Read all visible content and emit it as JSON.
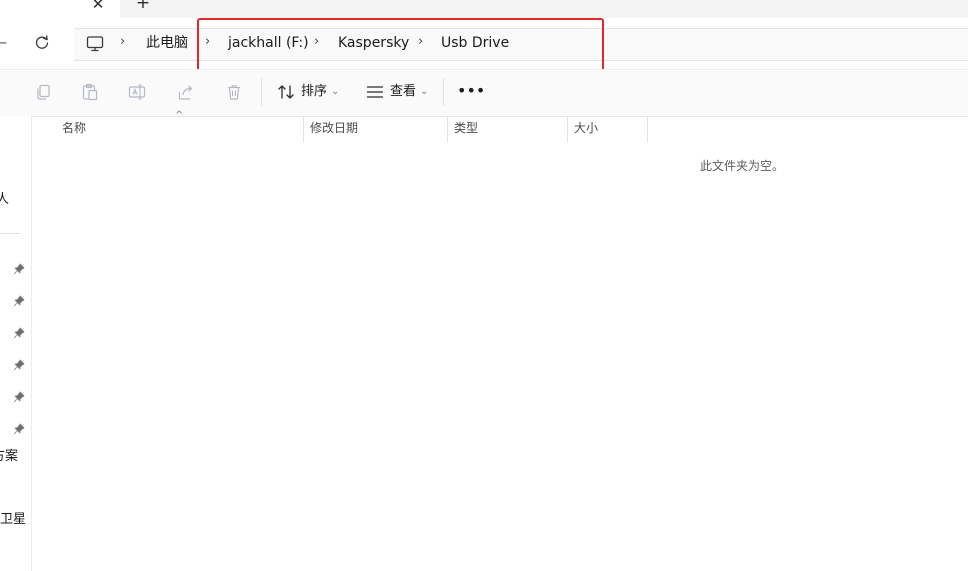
{
  "tabs": {
    "close_glyph": "✕",
    "new_tab_glyph": "+"
  },
  "nav": {
    "back_glyph": "←",
    "breadcrumb": {
      "root": "此电脑",
      "items": [
        "jackhall (F:)",
        "Kaspersky",
        "Usb Drive"
      ],
      "separator": "›"
    }
  },
  "toolbar": {
    "sort_label": "排序",
    "view_label": "查看",
    "more_glyph": "•••",
    "caret_glyph": "⌄"
  },
  "sidebar": {
    "partial_labels": [
      "人",
      "方案",
      "卫星"
    ]
  },
  "columns": {
    "name": "名称",
    "modified": "修改日期",
    "type": "类型",
    "size": "大小",
    "sort_caret": "^"
  },
  "content": {
    "empty_message": "此文件夹为空。"
  },
  "colors": {
    "highlight": "#e02a2a",
    "background": "#ffffff",
    "toolbar_bg": "#fafafa"
  },
  "icons": [
    "close-icon",
    "new-tab-icon",
    "back-icon",
    "refresh-icon",
    "computer-icon",
    "copy-icon",
    "paste-icon",
    "rename-icon",
    "share-icon",
    "delete-icon",
    "sort-icon",
    "view-icon",
    "more-icon",
    "pin-icon"
  ]
}
